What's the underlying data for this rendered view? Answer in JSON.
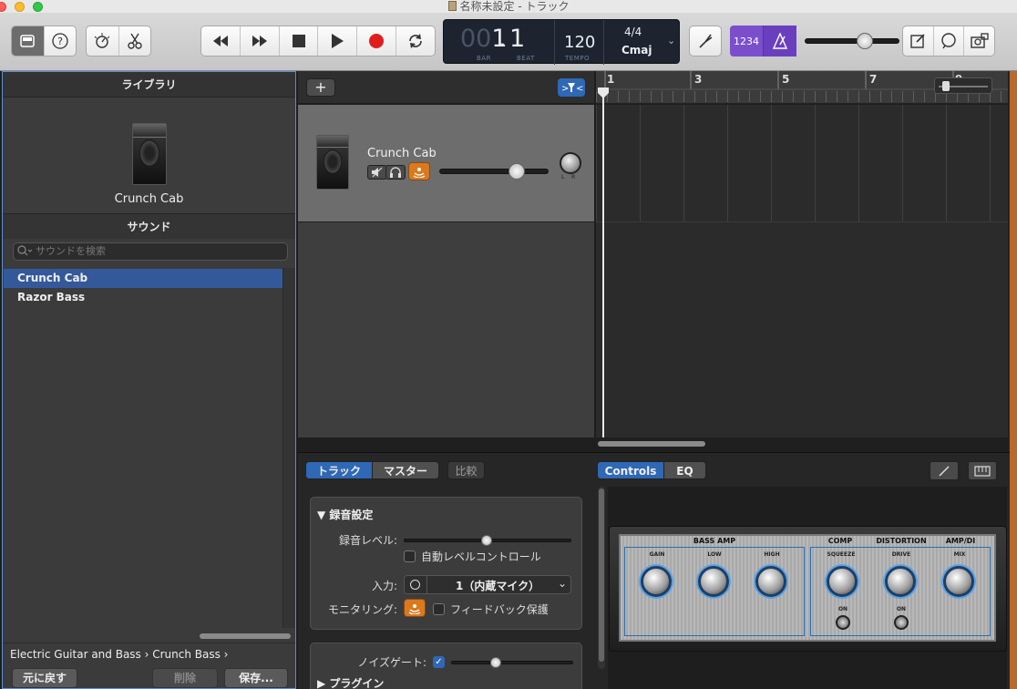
{
  "window": {
    "title": "名称未設定 - トラック"
  },
  "toolbar": {
    "lcd": {
      "bar_dim": "00",
      "bar": "1",
      "beat": "1",
      "bar_label": "BAR",
      "beat_label": "BEAT",
      "tempo": "120",
      "tempo_label": "TEMPO",
      "signature": "4/4",
      "key": "Cmaj"
    },
    "count_in": "1234"
  },
  "library": {
    "header": "ライブラリ",
    "preset_name": "Crunch Cab",
    "sounds_header": "サウンド",
    "search_placeholder": "サウンドを検索",
    "items": [
      {
        "label": "Crunch Cab",
        "selected": true
      },
      {
        "label": "Razor Bass",
        "selected": false
      }
    ],
    "breadcrumb": "Electric Guitar and Bass  › Crunch Bass  ›",
    "buttons": {
      "revert": "元に戻す",
      "delete": "削除",
      "save": "保存..."
    }
  },
  "tracks": {
    "add_label": "+",
    "track": {
      "name": "Crunch Cab",
      "volume": 0.72
    },
    "ruler": [
      "1",
      "3",
      "5",
      "7",
      "9"
    ]
  },
  "editor": {
    "tabs_left": [
      "トラック",
      "マスター"
    ],
    "compare": "比較",
    "tabs_right": [
      "Controls",
      "EQ"
    ],
    "record": {
      "header": "録音設定",
      "level_label": "録音レベル:",
      "auto_level": "自動レベルコントロール",
      "input_label": "入力:",
      "input_value": "1（内蔵マイク）",
      "monitoring_label": "モニタリング:",
      "feedback": "フィードバック保護"
    },
    "noise_gate_label": "ノイズゲート:",
    "plugins": "プラグイン",
    "amp": {
      "sections": {
        "bass_amp": "BASS AMP",
        "comp": "COMP",
        "distortion": "DISTORTION",
        "amp_di": "AMP/DI"
      },
      "knobs": {
        "gain": "GAIN",
        "low": "LOW",
        "high": "HIGH",
        "squeeze": "SQUEEZE",
        "drive": "DRIVE",
        "mix": "MIX"
      },
      "switch_on": "ON"
    }
  }
}
